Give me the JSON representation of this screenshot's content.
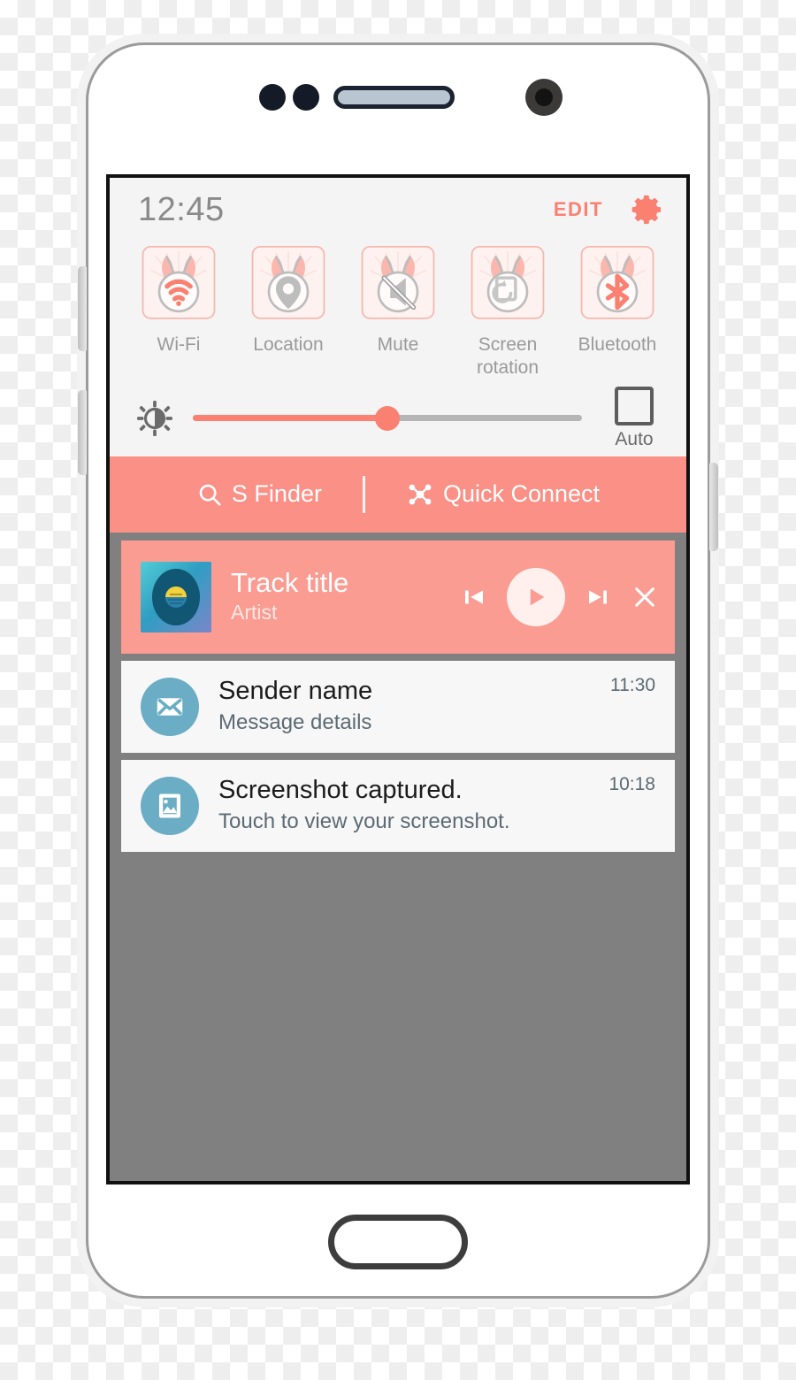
{
  "device": {
    "hardware": {
      "sensor_left": "proximity-sensor",
      "sensor_right": "light-sensor",
      "earpiece": "earpiece-speaker",
      "camera": "front-camera",
      "home": "home-button",
      "volume_up": "volume-up-button",
      "volume_down": "volume-down-button",
      "power": "power-button"
    }
  },
  "colors": {
    "accent": "#fa8072",
    "finder_bar": "#fa9086",
    "media_card": "#fa9c92",
    "panel_bg": "#f4f4f4",
    "shade_bg": "#808080",
    "notif_bg": "#f7f7f7",
    "avatar": "#6aadc4",
    "label_gray": "#9a9a9a"
  },
  "status_bar": {
    "clock": "12:45",
    "edit_label": "EDIT",
    "settings_icon": "gear-icon"
  },
  "quick_toggles": [
    {
      "label": "Wi-Fi",
      "icon": "wifi-icon",
      "state": "on"
    },
    {
      "label": "Location",
      "icon": "location-pin-icon",
      "state": "off"
    },
    {
      "label": "Mute",
      "icon": "mute-icon",
      "state": "off"
    },
    {
      "label": "Screen\nrotation",
      "icon": "screen-rotation-icon",
      "state": "off"
    },
    {
      "label": "Bluetooth",
      "icon": "bluetooth-icon",
      "state": "on"
    }
  ],
  "brightness": {
    "icon": "brightness-icon",
    "value_percent": 50,
    "auto_label": "Auto",
    "auto_checked": false
  },
  "finder_bar": {
    "s_finder_label": "S Finder",
    "s_finder_icon": "search-icon",
    "quick_connect_label": "Quick Connect",
    "quick_connect_icon": "quick-connect-icon"
  },
  "media_notification": {
    "album_art": "vinyl-record-art",
    "track_title": "Track title",
    "artist": "Artist",
    "controls": {
      "previous": "previous-track-icon",
      "play": "play-icon",
      "next": "next-track-icon",
      "close": "close-icon"
    }
  },
  "notifications": [
    {
      "icon": "envelope-icon",
      "title": "Sender name",
      "subtitle": "Message details",
      "time": "11:30"
    },
    {
      "icon": "image-icon",
      "title": "Screenshot captured.",
      "subtitle": "Touch to view your screenshot.",
      "time": "10:18"
    }
  ]
}
